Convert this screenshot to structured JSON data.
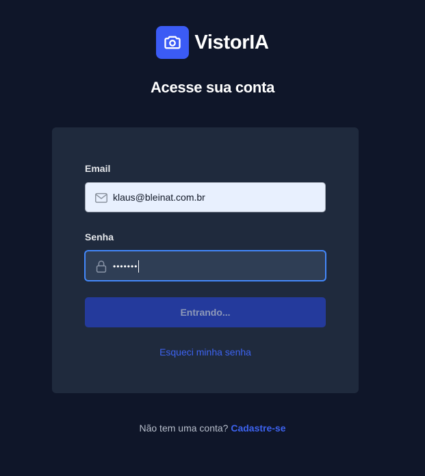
{
  "brand": {
    "name": "VistorIA",
    "logo_icon": "camera-icon",
    "logo_color": "#3b5bf5"
  },
  "page_title": "Acesse sua conta",
  "form": {
    "email_label": "Email",
    "email_value": "klaus@bleinat.com.br",
    "email_icon": "mail-icon",
    "password_label": "Senha",
    "password_value": "•••••••",
    "password_icon": "lock-icon",
    "submit_label": "Entrando...",
    "forgot_password": "Esqueci minha senha"
  },
  "footer": {
    "prompt": "Não tem uma conta?",
    "signup_link": "Cadastre-se"
  },
  "colors": {
    "background": "#0f1629",
    "card": "#1f2a3d",
    "accent": "#3d63f0"
  }
}
